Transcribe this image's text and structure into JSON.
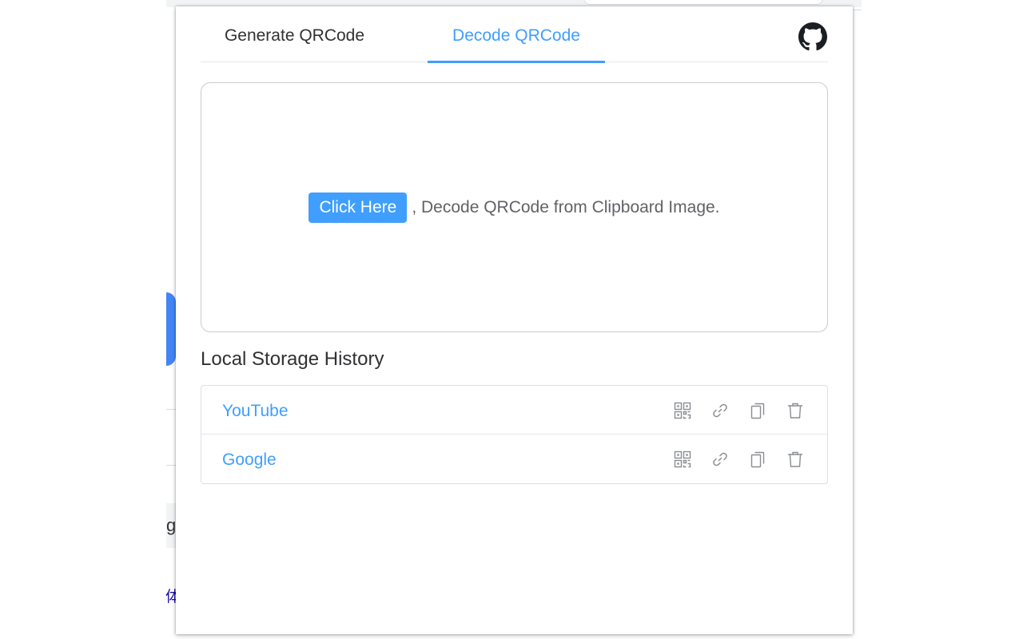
{
  "background": {
    "partial_glyph": "g",
    "partial_cjk": "体"
  },
  "tabs": [
    {
      "label": "Generate QRCode",
      "active": false
    },
    {
      "label": "Decode QRCode",
      "active": true
    }
  ],
  "header": {
    "github_icon": "github-icon"
  },
  "decode": {
    "button_label": "Click Here",
    "instruction": ", Decode QRCode from Clipboard Image."
  },
  "history": {
    "title": "Local Storage History",
    "items": [
      {
        "label": "YouTube",
        "actions": [
          "qrcode-icon",
          "link-icon",
          "copy-icon",
          "delete-icon"
        ]
      },
      {
        "label": "Google",
        "actions": [
          "qrcode-icon",
          "link-icon",
          "copy-icon",
          "delete-icon"
        ]
      }
    ]
  },
  "colors": {
    "accent": "#409eff",
    "text": "#303133",
    "secondary_text": "#606266",
    "border": "#dcdfe6",
    "icon": "#8a8d93"
  }
}
